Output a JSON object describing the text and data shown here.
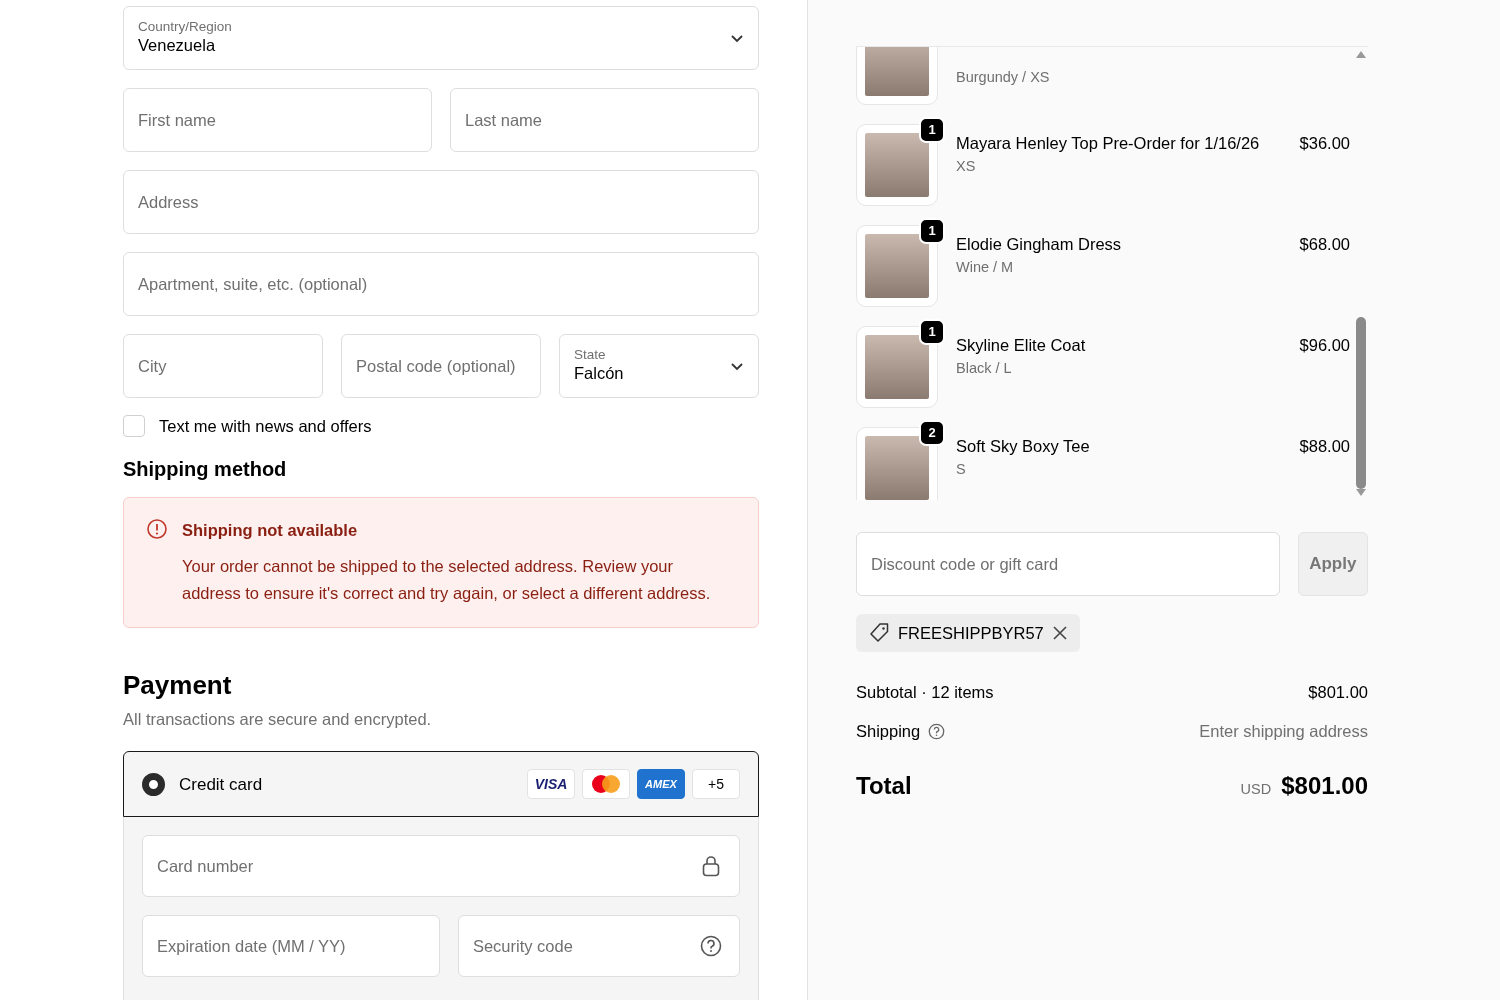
{
  "shipping_form": {
    "country": {
      "label": "Country/Region",
      "value": "Venezuela"
    },
    "first_name": {
      "placeholder": "First name"
    },
    "last_name": {
      "placeholder": "Last name"
    },
    "address": {
      "placeholder": "Address"
    },
    "apartment": {
      "placeholder": "Apartment, suite, etc. (optional)"
    },
    "city": {
      "placeholder": "City"
    },
    "postal_code": {
      "placeholder": "Postal code (optional)"
    },
    "state": {
      "label": "State",
      "value": "Falcón"
    },
    "sms_opt_in": {
      "label": "Text me with news and offers",
      "checked": false
    }
  },
  "shipping_method": {
    "heading": "Shipping method",
    "alert": {
      "title": "Shipping not available",
      "message": "Your order cannot be shipped to the selected address. Review your address to ensure it's correct and try again, or select a different address."
    }
  },
  "payment": {
    "heading": "Payment",
    "subtitle": "All transactions are secure and encrypted.",
    "methods": [
      {
        "label": "Credit card",
        "selected": true,
        "brands": [
          {
            "kind": "visa",
            "text": "VISA"
          },
          {
            "kind": "mastercard"
          },
          {
            "kind": "amex",
            "text": "AMEX"
          },
          {
            "kind": "more",
            "text": "+5"
          }
        ]
      }
    ],
    "card_number": {
      "placeholder": "Card number"
    },
    "expiration": {
      "placeholder": "Expiration date (MM / YY)"
    },
    "security_code": {
      "placeholder": "Security code"
    }
  },
  "order_items": [
    {
      "variant": "Burgundy / XS"
    },
    {
      "quantity": "1",
      "name": "Mayara Henley Top Pre-Order for 1/16/26",
      "variant": "XS",
      "price": "$36.00"
    },
    {
      "quantity": "1",
      "name": "Elodie Gingham Dress",
      "variant": "Wine / M",
      "price": "$68.00"
    },
    {
      "quantity": "1",
      "name": "Skyline Elite Coat",
      "variant": "Black / L",
      "price": "$96.00"
    },
    {
      "quantity": "2",
      "name": "Soft Sky Boxy Tee",
      "variant": "S",
      "price": "$88.00"
    }
  ],
  "discount": {
    "placeholder": "Discount code or gift card",
    "button": "Apply",
    "applied_code": "FREESHIPPBYR57"
  },
  "summary": {
    "subtotal_label": "Subtotal · 12 items",
    "subtotal": "$801.00",
    "shipping_label": "Shipping",
    "shipping": "Enter shipping address",
    "total_label": "Total",
    "currency": "USD",
    "total": "$801.00"
  }
}
